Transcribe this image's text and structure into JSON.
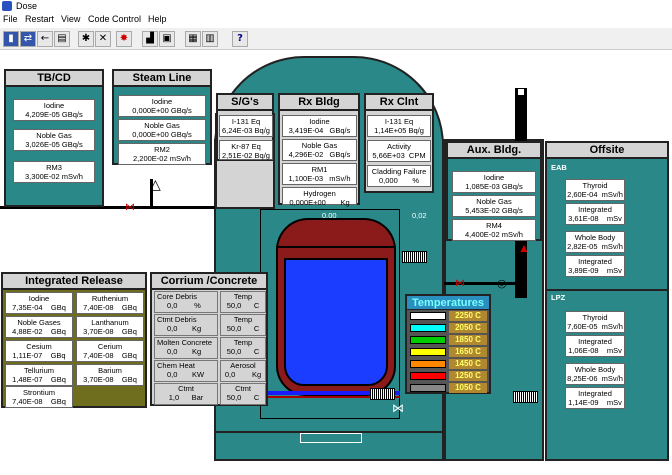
{
  "window": {
    "title": "Dose"
  },
  "menu": [
    "File",
    "Restart",
    "View",
    "Code Control",
    "Help"
  ],
  "toolbar": {
    "icons": [
      "exit-icon",
      "copy-icon",
      "back-icon",
      "print-icon",
      "run-icon",
      "stop-icon",
      "burst-icon",
      "chart-icon",
      "form-icon",
      "layout-icon",
      "grid-icon",
      "help-icon"
    ],
    "help": "?"
  },
  "tbcd": {
    "title": "TB/CD",
    "iodine": "Iodine\n4,209E-05 GBq/s",
    "noble": "Noble Gas\n3,026E-05 GBq/s",
    "rm3": "RM3\n3,300E-02 mSv/h"
  },
  "steam": {
    "title": "Steam Line",
    "iodine": "Iodine\n0,000E+00 GBq/s",
    "noble": "Noble Gas\n0,000E+00 GBq/s",
    "rm2": "RM2\n2,200E-02 mSv/h"
  },
  "sg": {
    "title": "S/G's",
    "i131": "I-131 Eq\n6,24E-03 Bq/g",
    "kr87": "Kr-87 Eq\n2,51E-02 Bq/g"
  },
  "rxbldg": {
    "title": "Rx Bldg",
    "iodine": "Iodine\n3,419E-04   GBq/s",
    "noble": "Noble Gas\n4,296E-02   GBq/s",
    "rm1": "RM1\n1,100E-03   mSv/h",
    "hydrogen": "Hydrogen\n0,000E+00       Kg"
  },
  "rxclnt": {
    "title": "Rx Clnt",
    "i131": "I-131 Eq\n1,14E+05 Bq/g",
    "activity": "Activity\n5,66E+03  CPM",
    "cladding": "Cladding Failure\n0,000       %"
  },
  "aux": {
    "title": "Aux. Bldg.",
    "iodine": "Iodine\n1,085E-03 GBq/s",
    "noble": "Noble Gas\n5,453E-02 GBq/s",
    "rm4": "RM4\n4,400E-02 mSv/h"
  },
  "offsite": {
    "title": "Offsite",
    "eab": "EAB",
    "eab_thyroid": "Thyroid\n2,60E-04  mSv/h",
    "eab_thyroid_int": "Integrated\n3,61E-08    mSv",
    "eab_wb": "Whole Body\n2,82E-05  mSv/h",
    "eab_wb_int": "Integrated\n3,89E-09    mSv",
    "lpz": "LPZ",
    "lpz_thyroid": "Thyroid\n7,60E-05  mSv/h",
    "lpz_thyroid_int": "Integrated\n1,06E-08    mSv",
    "lpz_wb": "Whole Body\n8,25E-06  mSv/h",
    "lpz_wb_int": "Integrated\n1,14E-09    mSv"
  },
  "integrated": {
    "title": "Integrated Release",
    "iodine": "Iodine\n7,35E-04    GBq",
    "ruthenium": "Ruthenium\n7,40E-08    GBq",
    "noble": "Noble Gases\n4,88E-02    GBq",
    "lanthanum": "Lanthanum\n3,70E-08    GBq",
    "cesium": "Cesium\n1,11E-07    GBq",
    "cerium": "Cerium\n7,40E-08    GBq",
    "tellurium": "Tellurium\n1,48E-07    GBq",
    "barium": "Barium\n3,70E-08    GBq",
    "strontium": "Strontium\n7,40E-08    GBq"
  },
  "corrium": {
    "title": "Corrium /Concrete",
    "core_debris_lbl": "Core Debris",
    "core_debris_val": "0,0        %",
    "temp1_lbl": "Temp",
    "temp1_val": "50,0      C",
    "ctmt_debris_lbl": "Ctmt Debris",
    "ctmt_debris_val": "0,0       Kg",
    "temp2_lbl": "Temp",
    "temp2_val": "50,0      C",
    "molten_lbl": "Molten Concrete",
    "molten_val": "0,0       Kg",
    "temp3_lbl": "Temp",
    "temp3_val": "50,0      C",
    "chem_lbl": "Chem Heat",
    "chem_val": "0,0       KW",
    "aerosol_lbl": "Aerosol",
    "aerosol_val": "0,0        Kg",
    "ctmt_lbl": "Ctmt",
    "ctmt_val": "1,0      Bar",
    "ctmt_temp_lbl": "Ctmt",
    "ctmt_temp_val": "50,0      C"
  },
  "vessel": {
    "left_val": "0,00",
    "right_val": "0,02"
  },
  "temperatures": {
    "title": "Temperatures",
    "rows": [
      {
        "color": "#ffffff",
        "label": "2250 C"
      },
      {
        "color": "#00ffff",
        "label": "2050 C"
      },
      {
        "color": "#00cc00",
        "label": "1850 C"
      },
      {
        "color": "#ffff00",
        "label": "1650 C"
      },
      {
        "color": "#ff8800",
        "label": "1450 C"
      },
      {
        "color": "#ff0000",
        "label": "1250 C"
      },
      {
        "color": "#888888",
        "label": "1050 C"
      }
    ]
  }
}
